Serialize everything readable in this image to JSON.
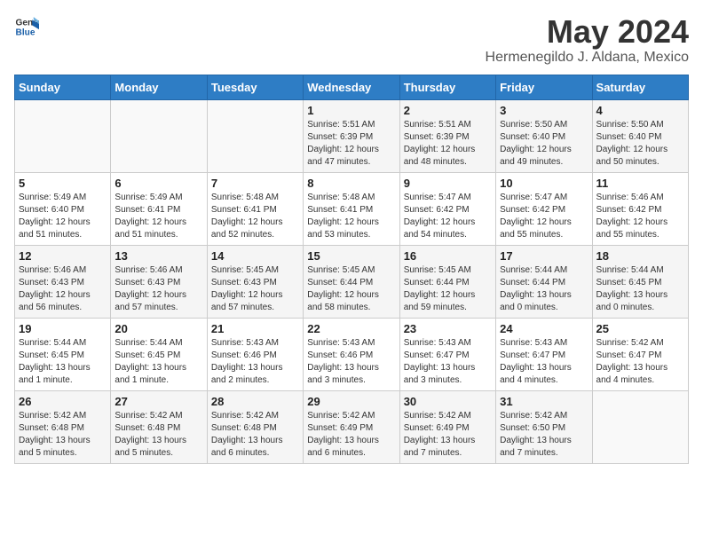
{
  "header": {
    "logo_general": "General",
    "logo_blue": "Blue",
    "title": "May 2024",
    "subtitle": "Hermenegildo J. Aldana, Mexico"
  },
  "weekdays": [
    "Sunday",
    "Monday",
    "Tuesday",
    "Wednesday",
    "Thursday",
    "Friday",
    "Saturday"
  ],
  "weeks": [
    [
      {
        "day": "",
        "info": ""
      },
      {
        "day": "",
        "info": ""
      },
      {
        "day": "",
        "info": ""
      },
      {
        "day": "1",
        "info": "Sunrise: 5:51 AM\nSunset: 6:39 PM\nDaylight: 12 hours\nand 47 minutes."
      },
      {
        "day": "2",
        "info": "Sunrise: 5:51 AM\nSunset: 6:39 PM\nDaylight: 12 hours\nand 48 minutes."
      },
      {
        "day": "3",
        "info": "Sunrise: 5:50 AM\nSunset: 6:40 PM\nDaylight: 12 hours\nand 49 minutes."
      },
      {
        "day": "4",
        "info": "Sunrise: 5:50 AM\nSunset: 6:40 PM\nDaylight: 12 hours\nand 50 minutes."
      }
    ],
    [
      {
        "day": "5",
        "info": "Sunrise: 5:49 AM\nSunset: 6:40 PM\nDaylight: 12 hours\nand 51 minutes."
      },
      {
        "day": "6",
        "info": "Sunrise: 5:49 AM\nSunset: 6:41 PM\nDaylight: 12 hours\nand 51 minutes."
      },
      {
        "day": "7",
        "info": "Sunrise: 5:48 AM\nSunset: 6:41 PM\nDaylight: 12 hours\nand 52 minutes."
      },
      {
        "day": "8",
        "info": "Sunrise: 5:48 AM\nSunset: 6:41 PM\nDaylight: 12 hours\nand 53 minutes."
      },
      {
        "day": "9",
        "info": "Sunrise: 5:47 AM\nSunset: 6:42 PM\nDaylight: 12 hours\nand 54 minutes."
      },
      {
        "day": "10",
        "info": "Sunrise: 5:47 AM\nSunset: 6:42 PM\nDaylight: 12 hours\nand 55 minutes."
      },
      {
        "day": "11",
        "info": "Sunrise: 5:46 AM\nSunset: 6:42 PM\nDaylight: 12 hours\nand 55 minutes."
      }
    ],
    [
      {
        "day": "12",
        "info": "Sunrise: 5:46 AM\nSunset: 6:43 PM\nDaylight: 12 hours\nand 56 minutes."
      },
      {
        "day": "13",
        "info": "Sunrise: 5:46 AM\nSunset: 6:43 PM\nDaylight: 12 hours\nand 57 minutes."
      },
      {
        "day": "14",
        "info": "Sunrise: 5:45 AM\nSunset: 6:43 PM\nDaylight: 12 hours\nand 57 minutes."
      },
      {
        "day": "15",
        "info": "Sunrise: 5:45 AM\nSunset: 6:44 PM\nDaylight: 12 hours\nand 58 minutes."
      },
      {
        "day": "16",
        "info": "Sunrise: 5:45 AM\nSunset: 6:44 PM\nDaylight: 12 hours\nand 59 minutes."
      },
      {
        "day": "17",
        "info": "Sunrise: 5:44 AM\nSunset: 6:44 PM\nDaylight: 13 hours\nand 0 minutes."
      },
      {
        "day": "18",
        "info": "Sunrise: 5:44 AM\nSunset: 6:45 PM\nDaylight: 13 hours\nand 0 minutes."
      }
    ],
    [
      {
        "day": "19",
        "info": "Sunrise: 5:44 AM\nSunset: 6:45 PM\nDaylight: 13 hours\nand 1 minute."
      },
      {
        "day": "20",
        "info": "Sunrise: 5:44 AM\nSunset: 6:45 PM\nDaylight: 13 hours\nand 1 minute."
      },
      {
        "day": "21",
        "info": "Sunrise: 5:43 AM\nSunset: 6:46 PM\nDaylight: 13 hours\nand 2 minutes."
      },
      {
        "day": "22",
        "info": "Sunrise: 5:43 AM\nSunset: 6:46 PM\nDaylight: 13 hours\nand 3 minutes."
      },
      {
        "day": "23",
        "info": "Sunrise: 5:43 AM\nSunset: 6:47 PM\nDaylight: 13 hours\nand 3 minutes."
      },
      {
        "day": "24",
        "info": "Sunrise: 5:43 AM\nSunset: 6:47 PM\nDaylight: 13 hours\nand 4 minutes."
      },
      {
        "day": "25",
        "info": "Sunrise: 5:42 AM\nSunset: 6:47 PM\nDaylight: 13 hours\nand 4 minutes."
      }
    ],
    [
      {
        "day": "26",
        "info": "Sunrise: 5:42 AM\nSunset: 6:48 PM\nDaylight: 13 hours\nand 5 minutes."
      },
      {
        "day": "27",
        "info": "Sunrise: 5:42 AM\nSunset: 6:48 PM\nDaylight: 13 hours\nand 5 minutes."
      },
      {
        "day": "28",
        "info": "Sunrise: 5:42 AM\nSunset: 6:48 PM\nDaylight: 13 hours\nand 6 minutes."
      },
      {
        "day": "29",
        "info": "Sunrise: 5:42 AM\nSunset: 6:49 PM\nDaylight: 13 hours\nand 6 minutes."
      },
      {
        "day": "30",
        "info": "Sunrise: 5:42 AM\nSunset: 6:49 PM\nDaylight: 13 hours\nand 7 minutes."
      },
      {
        "day": "31",
        "info": "Sunrise: 5:42 AM\nSunset: 6:50 PM\nDaylight: 13 hours\nand 7 minutes."
      },
      {
        "day": "",
        "info": ""
      }
    ]
  ]
}
